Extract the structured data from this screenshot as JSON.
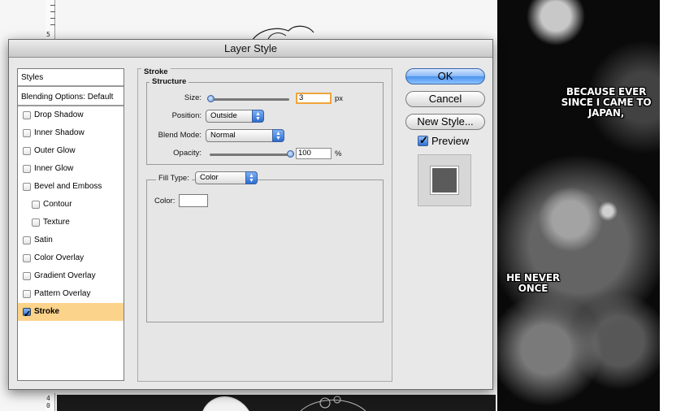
{
  "dialog": {
    "title": "Layer Style"
  },
  "styles_panel": {
    "header": "Styles",
    "blending_options": "Blending Options: Default",
    "items": [
      {
        "label": "Drop Shadow",
        "checked": false
      },
      {
        "label": "Inner Shadow",
        "checked": false
      },
      {
        "label": "Outer Glow",
        "checked": false
      },
      {
        "label": "Inner Glow",
        "checked": false
      },
      {
        "label": "Bevel and Emboss",
        "checked": false
      },
      {
        "label": "Contour",
        "checked": false
      },
      {
        "label": "Texture",
        "checked": false
      },
      {
        "label": "Satin",
        "checked": false
      },
      {
        "label": "Color Overlay",
        "checked": false
      },
      {
        "label": "Gradient Overlay",
        "checked": false
      },
      {
        "label": "Pattern Overlay",
        "checked": false
      },
      {
        "label": "Stroke",
        "checked": true
      }
    ]
  },
  "stroke": {
    "section_title": "Stroke",
    "structure_title": "Structure",
    "size_label": "Size:",
    "size_value": "3",
    "size_unit": "px",
    "position_label": "Position:",
    "position_value": "Outside",
    "blend_mode_label": "Blend Mode:",
    "blend_mode_value": "Normal",
    "opacity_label": "Opacity:",
    "opacity_value": "100",
    "opacity_unit": "%",
    "fill_type_label": "Fill Type:",
    "fill_type_value": "Color",
    "color_label": "Color:",
    "stroke_color": "#ffffff"
  },
  "buttons": {
    "ok": "OK",
    "cancel": "Cancel",
    "new_style": "New Style...",
    "preview_label": "Preview"
  },
  "canvas": {
    "ruler_top_number": "5",
    "ruler_bottom_numbers": [
      "4",
      "0"
    ],
    "bubble_1": [
      "BECAUSE EVER",
      "SINCE I CAME TO",
      "JAPAN,"
    ],
    "bubble_2": [
      "HE NEVER",
      "ONCE"
    ]
  }
}
